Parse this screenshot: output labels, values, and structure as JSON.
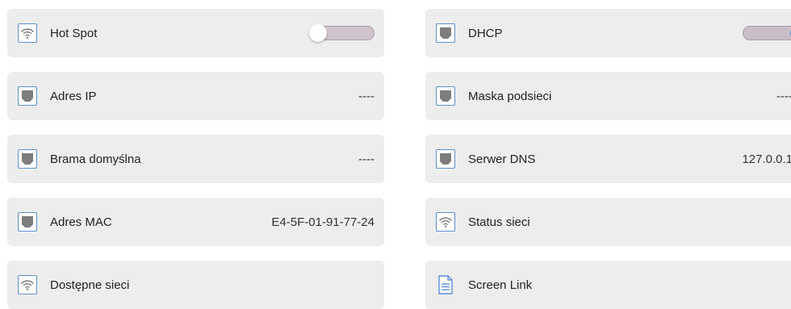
{
  "colors": {
    "tile_bg": "#ededed",
    "icon_accent": "#5a8fd6",
    "toggle_on_knob": "#4a90e2",
    "toggle_track": "#cfc4cc"
  },
  "left": {
    "hotspot": {
      "label": "Hot Spot",
      "icon": "wifi-icon",
      "toggle_state": "off"
    },
    "ip_address": {
      "label": "Adres IP",
      "icon": "ethernet-icon",
      "value": "----"
    },
    "default_gateway": {
      "label": "Brama domyślna",
      "icon": "ethernet-icon",
      "value": "----"
    },
    "mac_address": {
      "label": "Adres MAC",
      "icon": "ethernet-icon",
      "value": "E4-5F-01-91-77-24"
    },
    "available_networks": {
      "label": "Dostępne sieci",
      "icon": "wifi-icon"
    }
  },
  "right": {
    "dhcp": {
      "label": "DHCP",
      "icon": "ethernet-icon",
      "toggle_state": "on"
    },
    "subnet_mask": {
      "label": "Maska podsieci",
      "icon": "ethernet-icon",
      "value": "----"
    },
    "dns_server": {
      "label": "Serwer DNS",
      "icon": "ethernet-icon",
      "value": "127.0.0.1"
    },
    "network_status": {
      "label": "Status sieci",
      "icon": "wifi-icon"
    },
    "screen_link": {
      "label": "Screen Link",
      "icon": "document-icon"
    }
  }
}
